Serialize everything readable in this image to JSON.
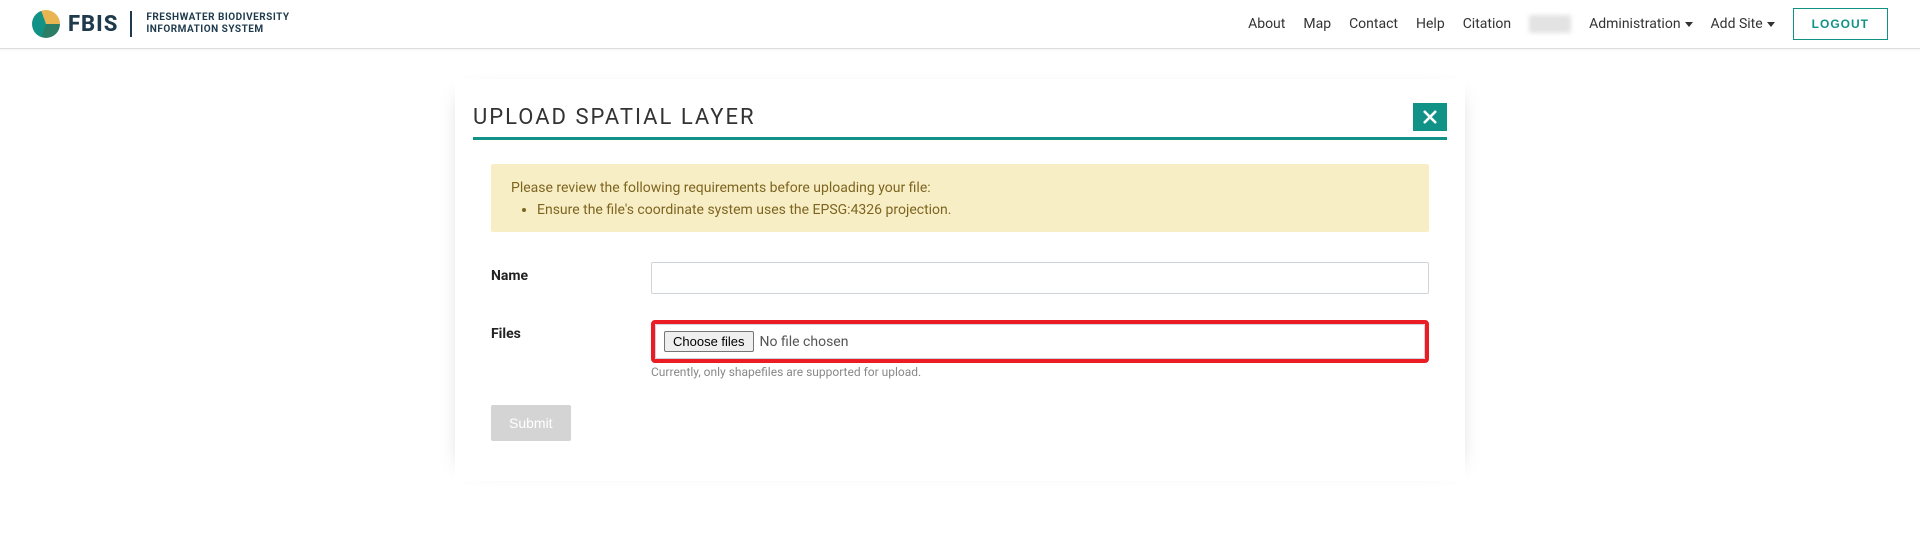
{
  "brand": {
    "main": "FBIS",
    "sub_line1": "FRESHWATER BIODIVERSITY",
    "sub_line2": "INFORMATION SYSTEM"
  },
  "nav": {
    "about": "About",
    "map": "Map",
    "contact": "Contact",
    "help": "Help",
    "citation": "Citation",
    "administration": "Administration",
    "add_site": "Add Site",
    "logout": "LOGOUT"
  },
  "page": {
    "title": "UPLOAD SPATIAL LAYER"
  },
  "alert": {
    "intro": "Please review the following requirements before uploading your file:",
    "items": [
      "Ensure the file's coordinate system uses the EPSG:4326 projection."
    ]
  },
  "form": {
    "name_label": "Name",
    "files_label": "Files",
    "choose_files": "Choose files",
    "no_file": "No file chosen",
    "files_help": "Currently, only shapefiles are supported for upload.",
    "submit": "Submit"
  }
}
